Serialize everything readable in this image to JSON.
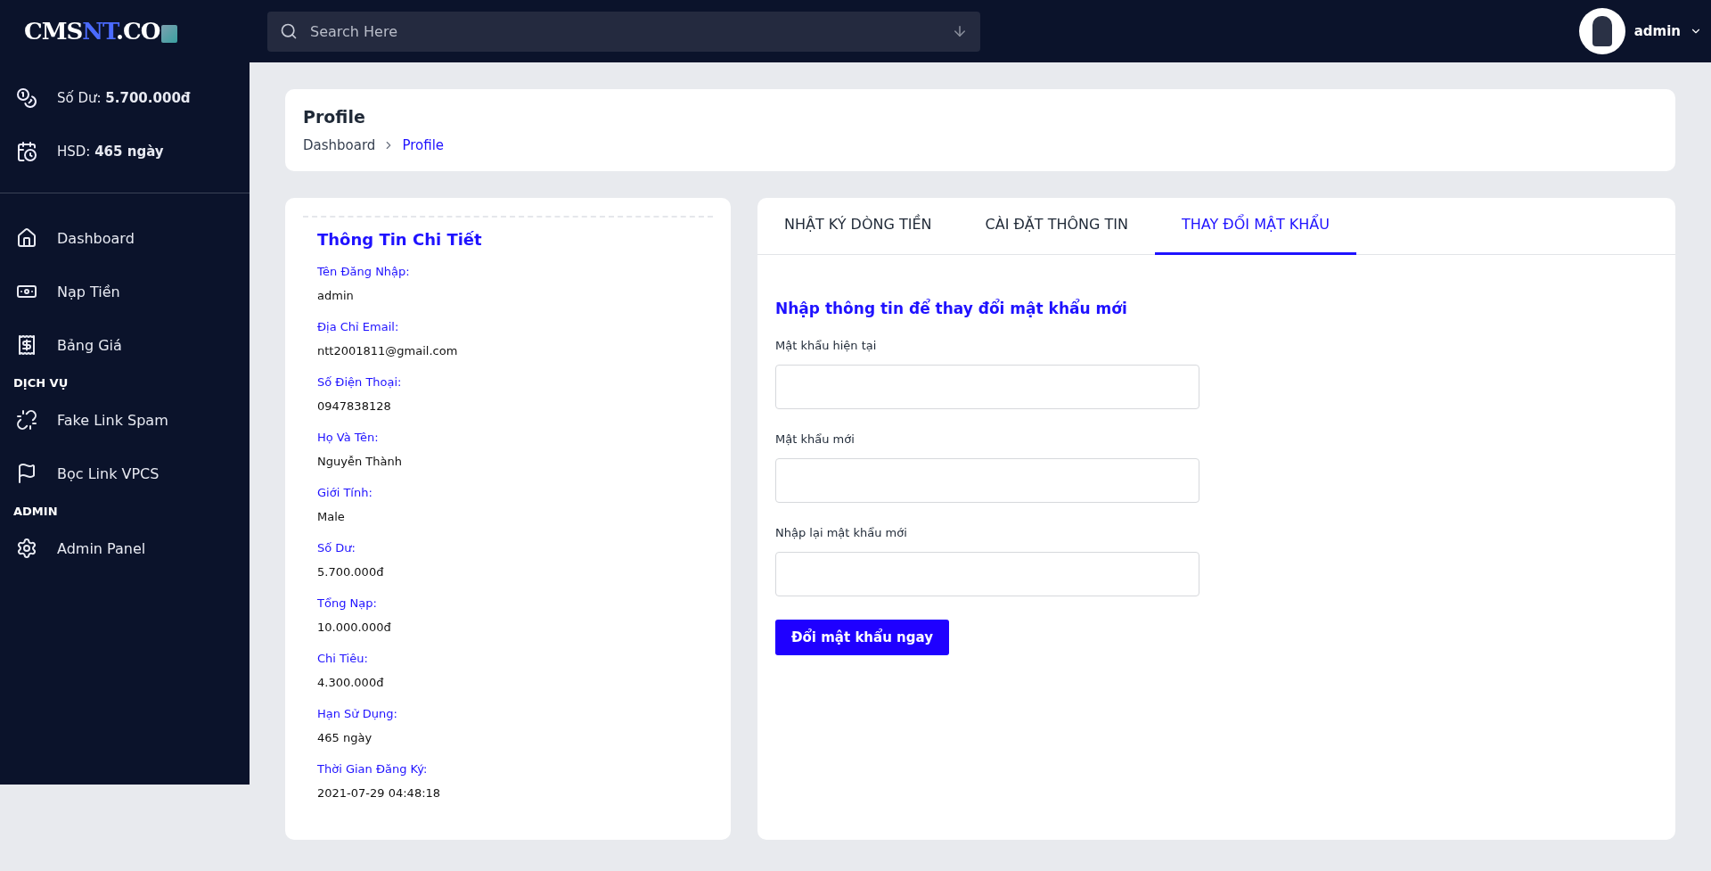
{
  "logo": {
    "parts": [
      {
        "text": "CMS",
        "accent": false
      },
      {
        "text": "NT",
        "accent": true
      },
      {
        "text": ".CO",
        "accent": false
      }
    ]
  },
  "search": {
    "placeholder": "Search Here"
  },
  "user": {
    "name": "admin"
  },
  "sidebar": {
    "stats": [
      {
        "label": "Số Dư: ",
        "value": "5.700.000đ"
      },
      {
        "label": "HSD: ",
        "value": "465 ngày"
      }
    ],
    "items": [
      {
        "kind": "link",
        "label": "Dashboard"
      },
      {
        "kind": "link",
        "label": "Nạp Tiền"
      },
      {
        "kind": "link",
        "label": "Bảng Giá"
      },
      {
        "kind": "section",
        "label": "DỊCH VỤ"
      },
      {
        "kind": "link",
        "label": "Fake Link Spam"
      },
      {
        "kind": "link",
        "label": "Bọc Link VPCS"
      },
      {
        "kind": "section",
        "label": "ADMIN"
      },
      {
        "kind": "link",
        "label": "Admin Panel"
      }
    ]
  },
  "page_header": {
    "title": "Profile",
    "breadcrumb": [
      {
        "label": "Dashboard",
        "current": false
      },
      {
        "label": "Profile",
        "current": true
      }
    ]
  },
  "details": {
    "title": "Thông Tin Chi Tiết",
    "fields": [
      {
        "label": "Tên Đăng Nhập:",
        "value": "admin"
      },
      {
        "label": "Địa Chỉ Email:",
        "value": "ntt2001811@gmail.com"
      },
      {
        "label": "Số Điện Thoại:",
        "value": "0947838128"
      },
      {
        "label": "Họ Và Tên:",
        "value": "Nguyễn Thành"
      },
      {
        "label": "Giới Tính:",
        "value": "Male"
      },
      {
        "label": "Số Dư:",
        "value": "5.700.000đ"
      },
      {
        "label": "Tổng Nạp:",
        "value": "10.000.000đ"
      },
      {
        "label": "Chi Tiêu:",
        "value": "4.300.000đ"
      },
      {
        "label": "Hạn Sử Dụng:",
        "value": "465 ngày"
      },
      {
        "label": "Thời Gian Đăng Ký:",
        "value": "2021-07-29 04:48:18"
      }
    ]
  },
  "tabs": [
    {
      "label": "NHẬT KÝ DÒNG TIỀN",
      "selected": false
    },
    {
      "label": "CÀI ĐẶT THÔNG TIN",
      "selected": false
    },
    {
      "label": "THAY ĐỔI MẬT KHẨU",
      "selected": true
    }
  ],
  "password_form": {
    "title": "Nhập thông tin để thay đổi mật khẩu mới",
    "fields": [
      {
        "label": "Mật khẩu hiện tại"
      },
      {
        "label": "Mật khẩu mới"
      },
      {
        "label": "Nhập lại mật khẩu mới"
      }
    ],
    "submit": "Đổi mật khẩu ngay"
  }
}
